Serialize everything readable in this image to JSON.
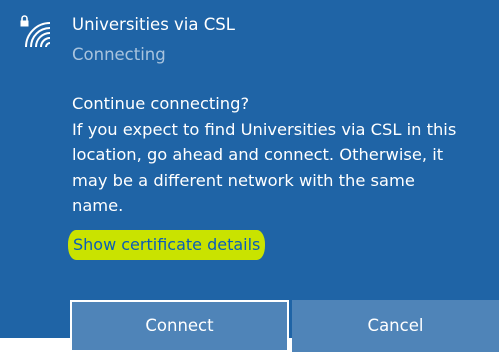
{
  "network": {
    "name": "Universities via CSL",
    "status": "Connecting",
    "icon": "wifi-secured-icon"
  },
  "message": {
    "question": "Continue connecting?",
    "lines": [
      "If you expect to find Universities via CSL in this",
      "location, go ahead and connect. Otherwise, it",
      "may be a different network with the same",
      "name."
    ]
  },
  "link": {
    "label": "Show certificate details",
    "highlight_color": "#c9e300"
  },
  "buttons": {
    "connect_label": "Connect",
    "cancel_label": "Cancel"
  },
  "colors": {
    "panel_bg": "#1f64a6",
    "button_bg": "#4f84b8",
    "status_text": "#a9c4de",
    "link_text": "#0b5db8"
  }
}
